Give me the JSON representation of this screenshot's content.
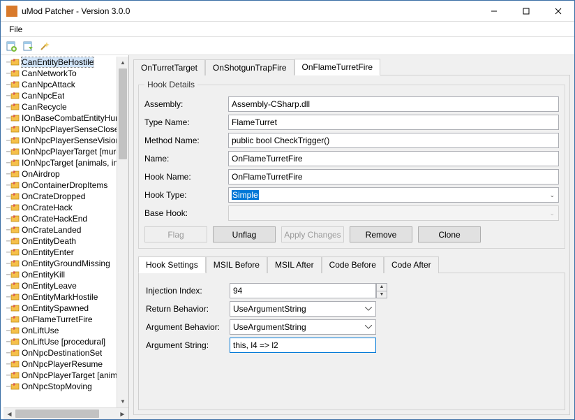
{
  "window": {
    "title": "uMod Patcher - Version 3.0.0"
  },
  "menubar": {
    "file": "File"
  },
  "tree": {
    "items": [
      "CanEntityBeHostile",
      "CanNetworkTo",
      "CanNpcAttack",
      "CanNpcEat",
      "CanRecycle",
      "IOnBaseCombatEntityHurt",
      "IOnNpcPlayerSenseClose",
      "IOnNpcPlayerSenseVision",
      "IOnNpcPlayerTarget [murd",
      "IOnNpcTarget [animals, int",
      "OnAirdrop",
      "OnContainerDropItems",
      "OnCrateDropped",
      "OnCrateHack",
      "OnCrateHackEnd",
      "OnCrateLanded",
      "OnEntityDeath",
      "OnEntityEnter",
      "OnEntityGroundMissing",
      "OnEntityKill",
      "OnEntityLeave",
      "OnEntityMarkHostile",
      "OnEntitySpawned",
      "OnFlameTurretFire",
      "OnLiftUse",
      "OnLiftUse [procedural]",
      "OnNpcDestinationSet",
      "OnNpcPlayerResume",
      "OnNpcPlayerTarget [anima",
      "OnNpcStopMoving"
    ],
    "selected_index": 0
  },
  "top_tabs": {
    "items": [
      "OnTurretTarget",
      "OnShotgunTrapFire",
      "OnFlameTurretFire"
    ],
    "active_index": 2
  },
  "hook_details": {
    "legend": "Hook Details",
    "labels": {
      "assembly": "Assembly:",
      "type_name": "Type Name:",
      "method_name": "Method Name:",
      "name": "Name:",
      "hook_name": "Hook Name:",
      "hook_type": "Hook Type:",
      "base_hook": "Base Hook:"
    },
    "values": {
      "assembly": "Assembly-CSharp.dll",
      "type_name": "FlameTurret",
      "method_name": "public bool CheckTrigger()",
      "name": "OnFlameTurretFire",
      "hook_name": "OnFlameTurretFire",
      "hook_type": "Simple",
      "base_hook": ""
    },
    "buttons": {
      "flag": "Flag",
      "unflag": "Unflag",
      "apply": "Apply Changes",
      "remove": "Remove",
      "clone": "Clone"
    }
  },
  "sub_tabs": {
    "items": [
      "Hook Settings",
      "MSIL Before",
      "MSIL After",
      "Code Before",
      "Code After"
    ],
    "active_index": 0
  },
  "hook_settings": {
    "labels": {
      "injection_index": "Injection Index:",
      "return_behavior": "Return Behavior:",
      "argument_behavior": "Argument Behavior:",
      "argument_string": "Argument String:"
    },
    "values": {
      "injection_index": "94",
      "return_behavior": "UseArgumentString",
      "argument_behavior": "UseArgumentString",
      "argument_string": "this, l4 => l2"
    }
  }
}
